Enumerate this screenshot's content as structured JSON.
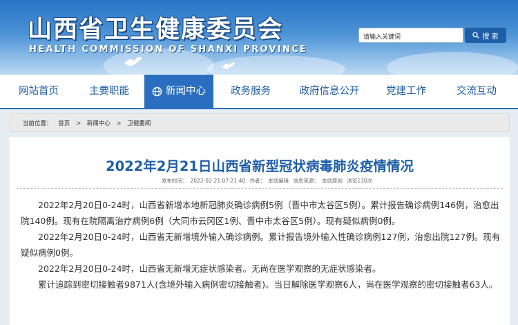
{
  "header": {
    "title": "山西省卫生健康委员会",
    "subtitle": "HEALTH COMMISSION OF SHANXI PROVINCE",
    "search": {
      "value": "请输入关键词",
      "button_label": "搜 索"
    }
  },
  "nav": {
    "items": [
      {
        "label": "网站首页",
        "active": false
      },
      {
        "label": "主要职能",
        "active": false
      },
      {
        "label": "新闻中心",
        "active": true
      },
      {
        "label": "政务服务",
        "active": false
      },
      {
        "label": "政府信息公开",
        "active": false
      },
      {
        "label": "党建工作",
        "active": false
      },
      {
        "label": "交流互动",
        "active": false
      }
    ]
  },
  "breadcrumb": {
    "prefix": "当前位置：",
    "items": [
      "首页",
      "新闻中心",
      "卫健要闻"
    ],
    "sep": ">"
  },
  "article": {
    "title": "2022年2月21日山西省新型冠状病毒肺炎疫情情况",
    "meta": {
      "published_label": "发布时间：",
      "published": "2022-02-21 07:21:40",
      "author_label": "作者：",
      "author": "本站编辑",
      "source_label": "信息来源：",
      "source": "本站原创",
      "views": "浏览130次"
    },
    "paragraphs": [
      "2022年2月20日0-24时，山西省新增本地新冠肺炎确诊病例5例（晋中市太谷区5例）。累计报告确诊病例146例，治愈出院140例。现有在院隔离治疗病例6例（大同市云冈区1例、晋中市太谷区5例）。现有疑似病例0例。",
      "2022年2月20日0-24时，山西省无新增境外输入确诊病例。累计报告境外输入性确诊病例127例，治愈出院127例。现有疑似病例0例。",
      "2022年2月20日0-24时，山西省无新增无症状感染者。无尚在医学观察的无症状感染者。",
      "累计追踪到密切接触者9871人(含境外输入病例密切接触者)。当日解除医学观察6人，尚在医学观察的密切接触者63人。"
    ]
  },
  "colors": {
    "brand_blue": "#2a6fbf",
    "title_blue": "#1f5ea8"
  }
}
